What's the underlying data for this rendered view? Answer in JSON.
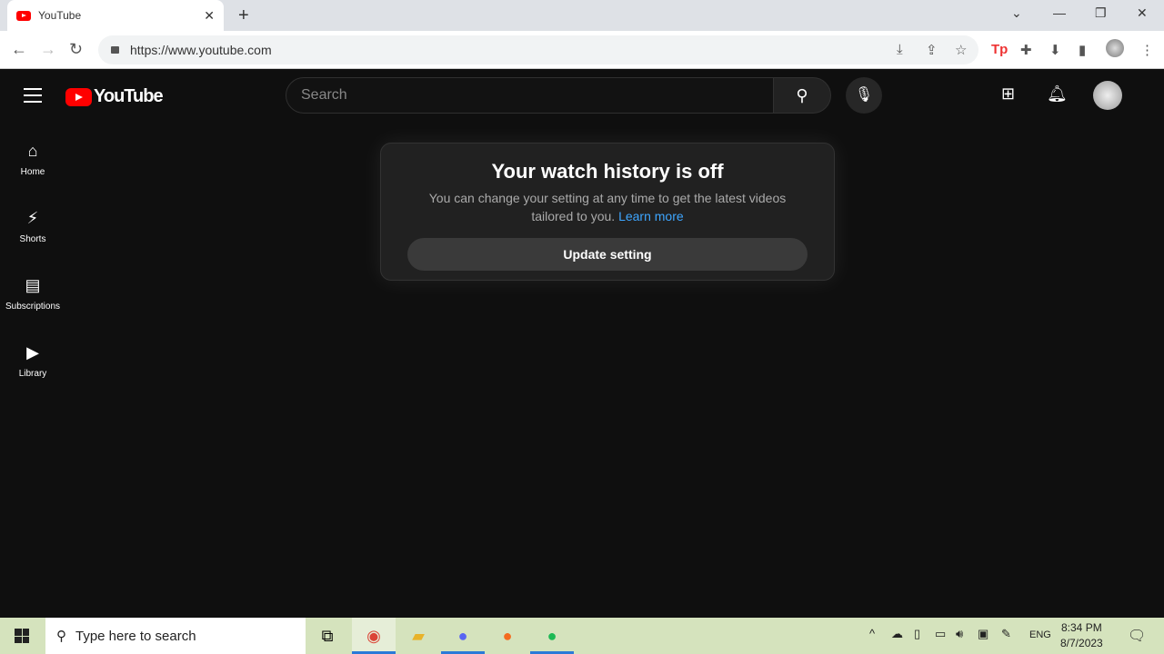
{
  "browser": {
    "tab_title": "YouTube",
    "url": "https://www.youtube.com"
  },
  "youtube": {
    "logo": "YouTube",
    "search_placeholder": "Search",
    "sidebar": [
      {
        "label": "Home",
        "icon": "home-icon"
      },
      {
        "label": "Shorts",
        "icon": "shorts-icon"
      },
      {
        "label": "Subscriptions",
        "icon": "subscriptions-icon"
      },
      {
        "label": "Library",
        "icon": "library-icon"
      }
    ],
    "card": {
      "title": "Your watch history is off",
      "text": "You can change your setting at any time to get the latest videos tailored to you.",
      "link": "Learn more",
      "button": "Update setting"
    }
  },
  "taskbar": {
    "search_placeholder": "Type here to search",
    "language": "ENG",
    "time": "8:34 PM",
    "date": "8/7/2023"
  },
  "colors": {
    "accent": "#ff0000",
    "link": "#3ea6ff",
    "taskbar": "#d5e3bd"
  }
}
